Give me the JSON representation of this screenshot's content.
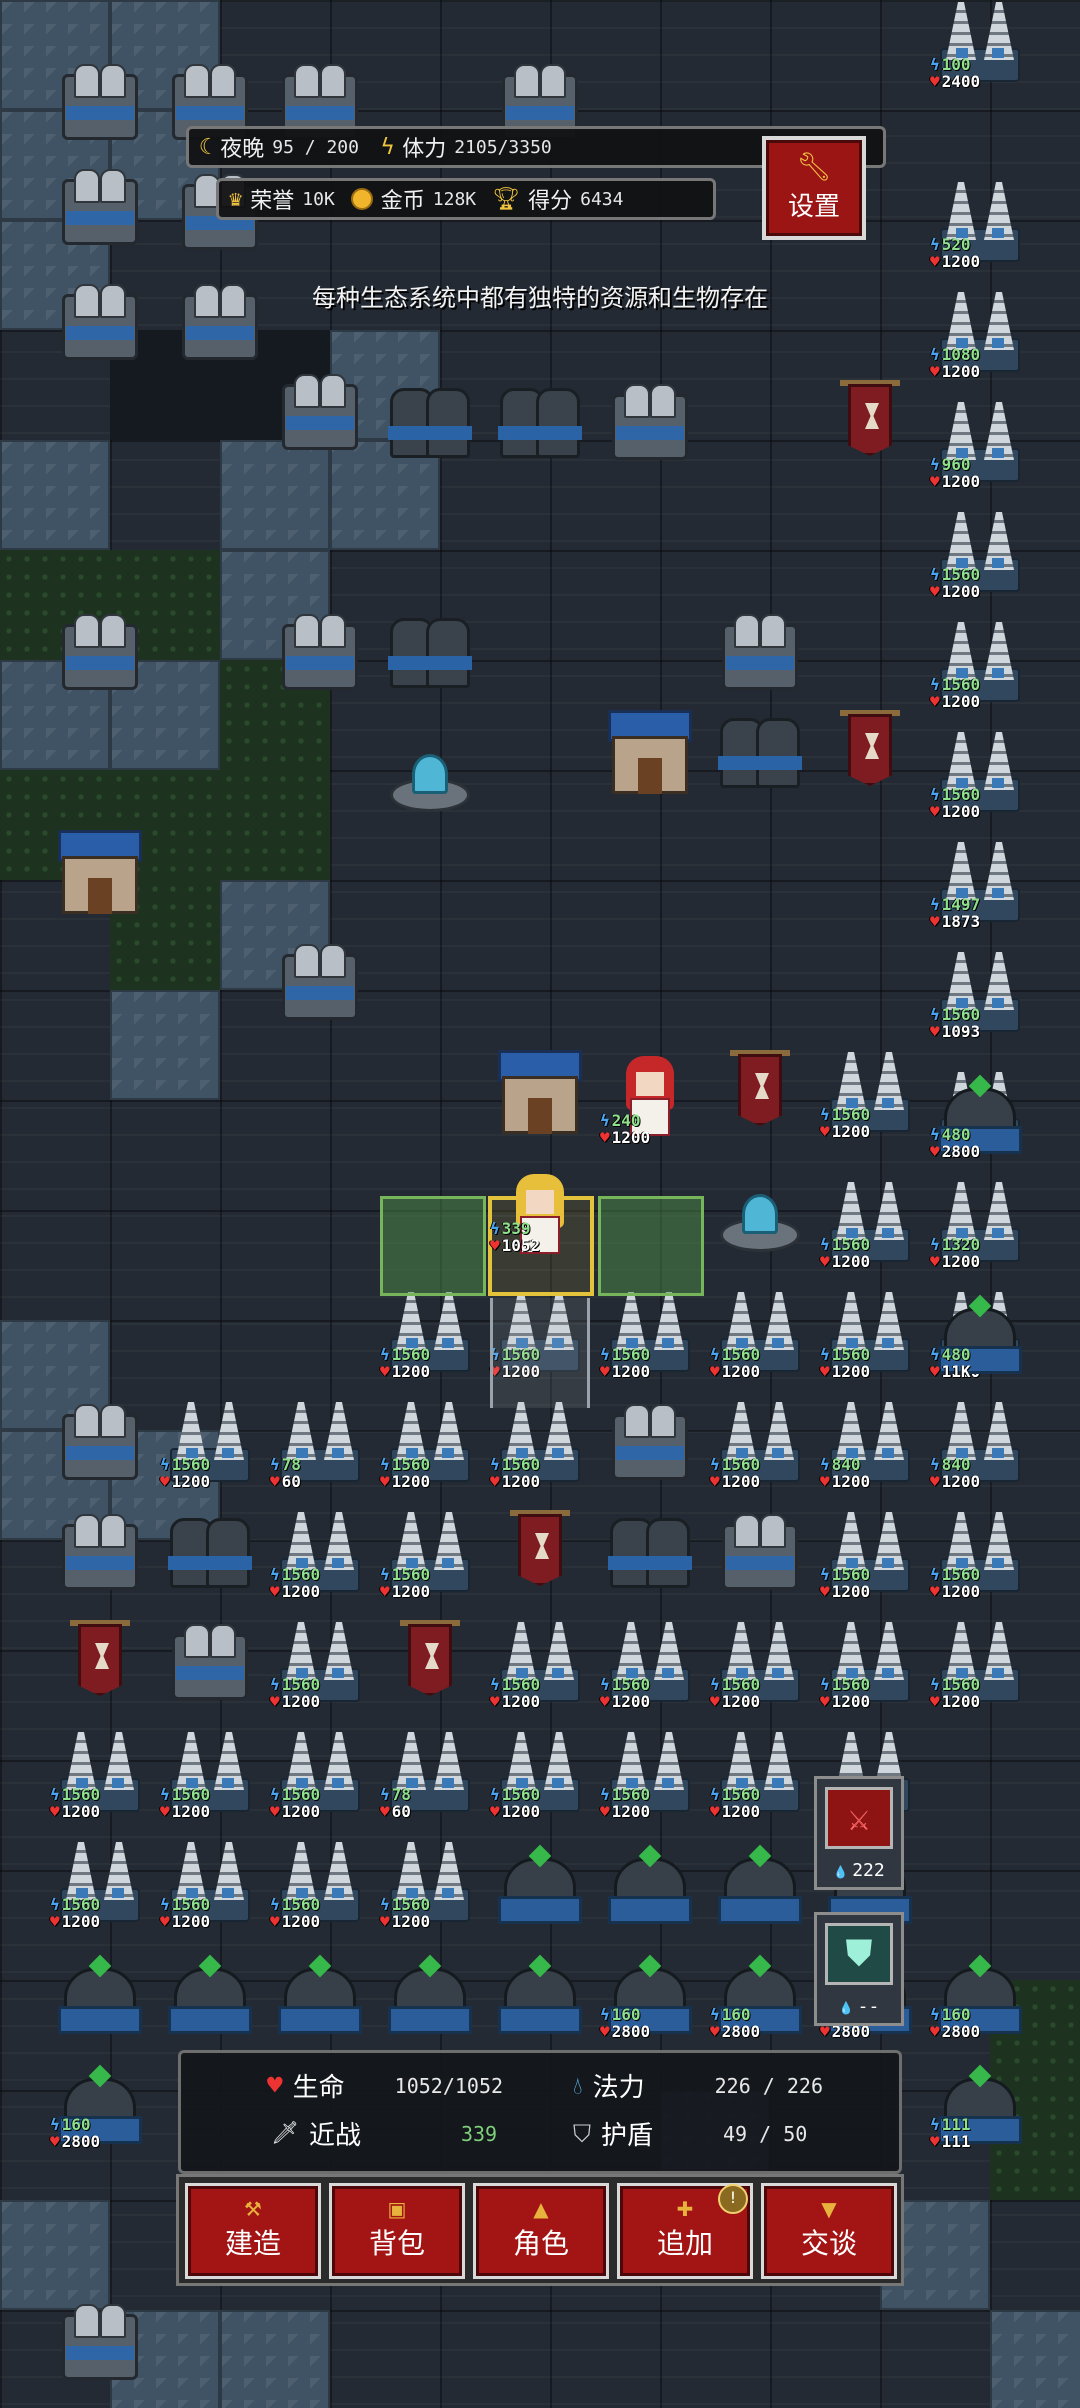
{
  "hud": {
    "time_label": "夜晚",
    "time_value": "95 / 200",
    "stamina_label": "体力",
    "stamina_value": "2105/3350",
    "honor_label": "荣誉",
    "honor_value": "10K",
    "gold_label": "金币",
    "gold_value": "128K",
    "score_label": "得分",
    "score_value": "6434",
    "settings_label": "设置",
    "tip": "每种生态系统中都有独特的资源和生物存在"
  },
  "side_buttons": [
    {
      "name": "attack",
      "icon": "red-sword-icon",
      "count": "222"
    },
    {
      "name": "shield",
      "icon": "green-shield-icon",
      "count": "--"
    }
  ],
  "player_stats": {
    "life_label": "生命",
    "life_value": "1052/1052",
    "mana_label": "法力",
    "mana_value": "226 / 226",
    "melee_label": "近战",
    "melee_value": "339",
    "armor_label": "护盾",
    "armor_value": "49 / 50"
  },
  "bottom_buttons": [
    {
      "label": "建造",
      "icon": "hammer-icon"
    },
    {
      "label": "背包",
      "icon": "bag-icon"
    },
    {
      "label": "角色",
      "icon": "character-icon"
    },
    {
      "label": "追加",
      "icon": "plus-icon",
      "badge": "!"
    },
    {
      "label": "交谈",
      "icon": "speech-icon"
    }
  ],
  "units": {
    "hero": {
      "top": "339",
      "hp": "1052"
    },
    "red_hood": {
      "top": "240",
      "hp": "1200"
    },
    "tower_stats": [
      {
        "top": "100",
        "hp": "2400"
      },
      {
        "top": "520",
        "hp": "1200"
      },
      {
        "top": "1080",
        "hp": "1200"
      },
      {
        "top": "960",
        "hp": "1200"
      },
      {
        "top": "1560",
        "hp": "1200"
      },
      {
        "top": "1497",
        "hp": "1873"
      },
      {
        "top": "1560",
        "hp": "1093"
      },
      {
        "top": "1560",
        "hp": "1200"
      },
      {
        "top": "1320",
        "hp": "1200"
      },
      {
        "top": "480",
        "hp": "2800"
      },
      {
        "top": "480",
        "hp": "11K"
      },
      {
        "top": "78",
        "hp": "60"
      },
      {
        "top": "840",
        "hp": "1200"
      },
      {
        "top": "160",
        "hp": "2800"
      },
      {
        "top": "111",
        "hp": "111"
      }
    ]
  },
  "colors": {
    "button_red": "#a31414",
    "health_red": "#e33333",
    "stamina_yellow": "#f2c53f",
    "mana_blue": "#4aa3f0"
  }
}
